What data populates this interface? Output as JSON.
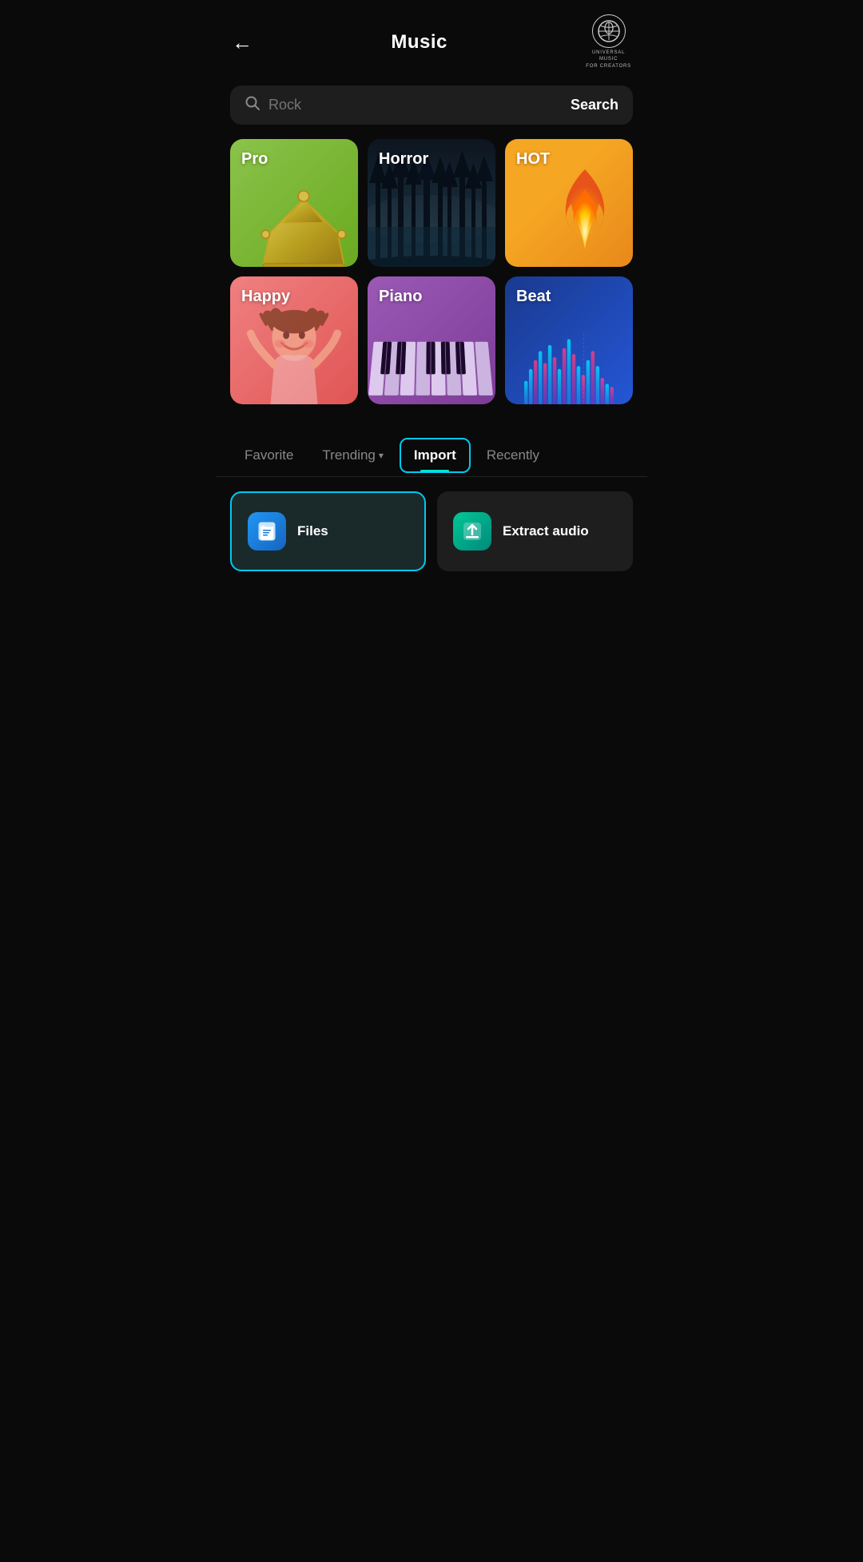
{
  "header": {
    "back_label": "←",
    "title": "Music",
    "logo_line1": "UNIVERSAL",
    "logo_line2": "UNIVERSAL MUSIC",
    "logo_line3": "FOR CREATORS"
  },
  "search": {
    "placeholder": "Rock",
    "button_label": "Search",
    "icon": "🔍"
  },
  "genre_cards": [
    {
      "id": "pro",
      "label": "Pro",
      "style": "card-pro",
      "icon": "👑"
    },
    {
      "id": "horror",
      "label": "Horror",
      "style": "card-horror",
      "icon": "🌲"
    },
    {
      "id": "hot",
      "label": "HOT",
      "style": "card-hot",
      "icon": "🔥"
    },
    {
      "id": "happy",
      "label": "Happy",
      "style": "card-happy",
      "icon": "😄"
    },
    {
      "id": "piano",
      "label": "Piano",
      "style": "card-piano",
      "icon": "🎹"
    },
    {
      "id": "beat",
      "label": "Beat",
      "style": "card-beat",
      "icon": "🎵"
    }
  ],
  "tabs": [
    {
      "id": "favorite",
      "label": "Favorite",
      "active": false
    },
    {
      "id": "trending",
      "label": "Trending",
      "active": false,
      "has_dropdown": true
    },
    {
      "id": "import",
      "label": "Import",
      "active": true
    },
    {
      "id": "recently",
      "label": "Recently",
      "active": false
    }
  ],
  "import_options": [
    {
      "id": "files",
      "label": "Files",
      "icon_type": "files",
      "selected": true
    },
    {
      "id": "extract-audio",
      "label": "Extract audio",
      "icon_type": "extract",
      "selected": false
    }
  ],
  "colors": {
    "accent": "#00c8f0",
    "background": "#0a0a0a",
    "card_bg": "#1e1e1e"
  }
}
